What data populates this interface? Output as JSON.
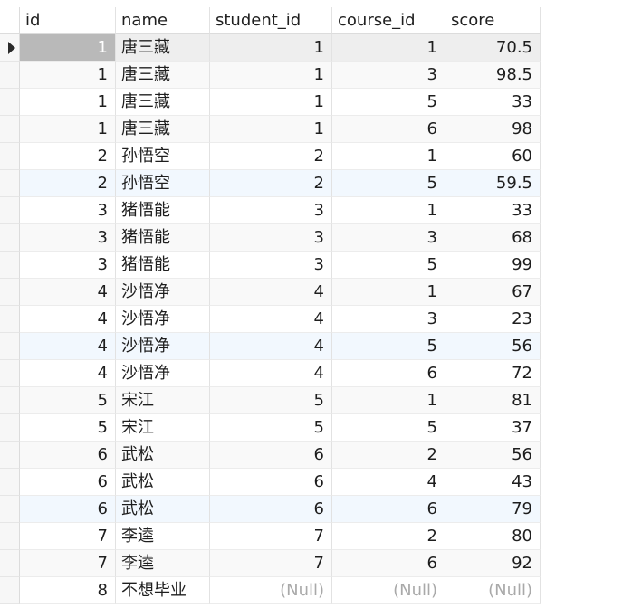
{
  "columns": [
    "id",
    "name",
    "student_id",
    "course_id",
    "score"
  ],
  "rows": [
    [
      "1",
      "唐三藏",
      "1",
      "1",
      "70.5"
    ],
    [
      "1",
      "唐三藏",
      "1",
      "3",
      "98.5"
    ],
    [
      "1",
      "唐三藏",
      "1",
      "5",
      "33"
    ],
    [
      "1",
      "唐三藏",
      "1",
      "6",
      "98"
    ],
    [
      "2",
      "孙悟空",
      "2",
      "1",
      "60"
    ],
    [
      "2",
      "孙悟空",
      "2",
      "5",
      "59.5"
    ],
    [
      "3",
      "猪悟能",
      "3",
      "1",
      "33"
    ],
    [
      "3",
      "猪悟能",
      "3",
      "3",
      "68"
    ],
    [
      "3",
      "猪悟能",
      "3",
      "5",
      "99"
    ],
    [
      "4",
      "沙悟净",
      "4",
      "1",
      "67"
    ],
    [
      "4",
      "沙悟净",
      "4",
      "3",
      "23"
    ],
    [
      "4",
      "沙悟净",
      "4",
      "5",
      "56"
    ],
    [
      "4",
      "沙悟净",
      "4",
      "6",
      "72"
    ],
    [
      "5",
      "宋江",
      "5",
      "1",
      "81"
    ],
    [
      "5",
      "宋江",
      "5",
      "5",
      "37"
    ],
    [
      "6",
      "武松",
      "6",
      "2",
      "56"
    ],
    [
      "6",
      "武松",
      "6",
      "4",
      "43"
    ],
    [
      "6",
      "武松",
      "6",
      "6",
      "79"
    ],
    [
      "7",
      "李逵",
      "7",
      "2",
      "80"
    ],
    [
      "7",
      "李逵",
      "7",
      "6",
      "92"
    ],
    [
      "8",
      "不想毕业",
      "(Null)",
      "(Null)",
      "(Null)"
    ]
  ],
  "selected_row": 0,
  "highlight_rows": [
    5,
    11,
    17
  ],
  "row_indicator_icon": "current-row-arrow-icon"
}
